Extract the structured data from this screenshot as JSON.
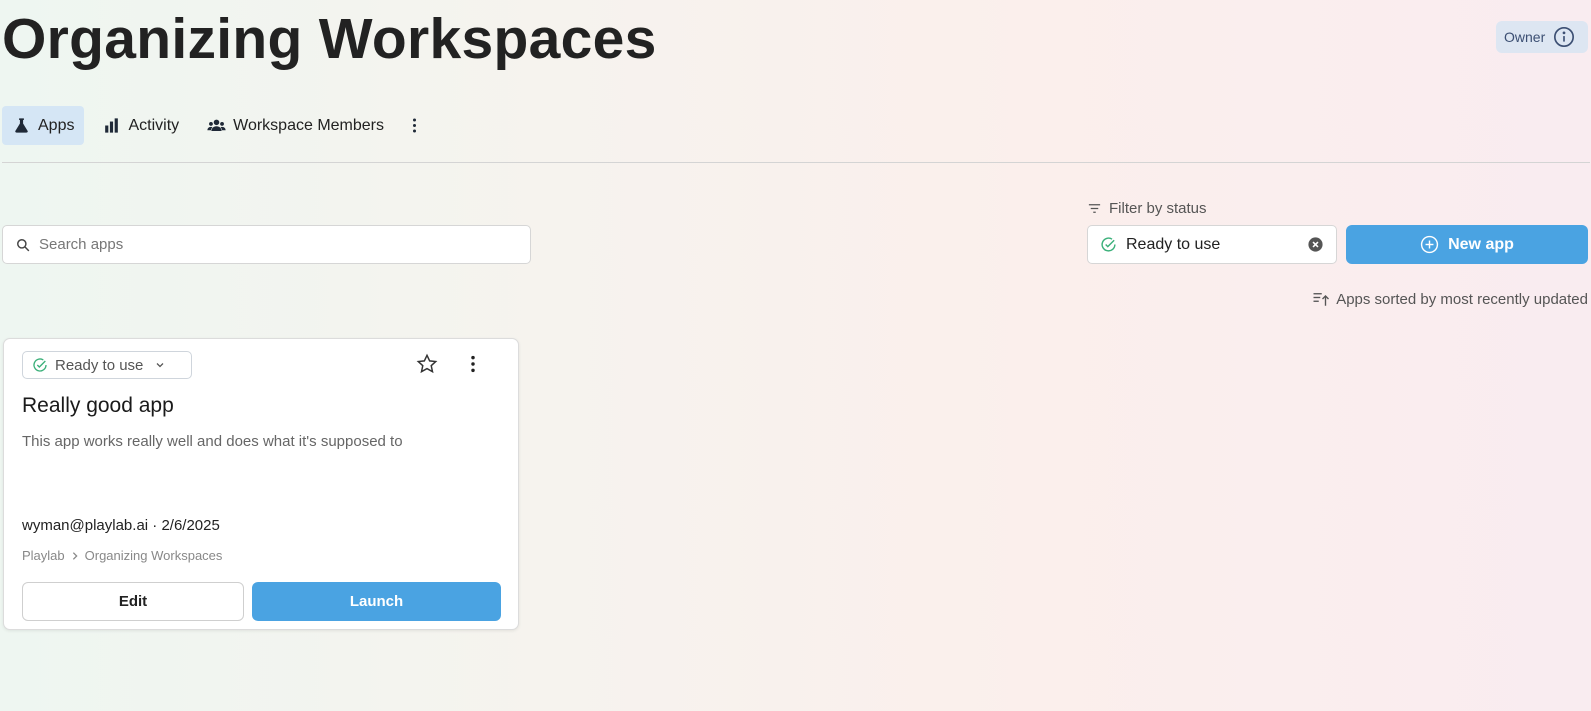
{
  "page": {
    "title": "Organizing Workspaces"
  },
  "role_badge": {
    "label": "Owner",
    "icon": "info-icon"
  },
  "tabs": [
    {
      "label": "Apps",
      "icon": "flask-icon",
      "active": true
    },
    {
      "label": "Activity",
      "icon": "bar-chart-icon",
      "active": false
    },
    {
      "label": "Workspace Members",
      "icon": "users-icon",
      "active": false
    }
  ],
  "search": {
    "placeholder": "Search apps",
    "value": ""
  },
  "filter": {
    "label": "Filter by status",
    "selected": "Ready to use"
  },
  "new_app_button": {
    "label": "New app"
  },
  "sort": {
    "label": "Apps sorted by most recently updated"
  },
  "apps": [
    {
      "status": "Ready to use",
      "title": "Really good app",
      "description": "This app works really well and does what it's supposed to",
      "meta": "wyman@playlab.ai · 2/6/2025",
      "breadcrumb": [
        "Playlab",
        "Organizing Workspaces"
      ],
      "edit_label": "Edit",
      "launch_label": "Launch"
    }
  ],
  "colors": {
    "accent": "#4aa3e2",
    "tab_active_bg": "#d5e6f5",
    "status_green": "#3bb07a",
    "badge_bg": "#dde6f2"
  }
}
